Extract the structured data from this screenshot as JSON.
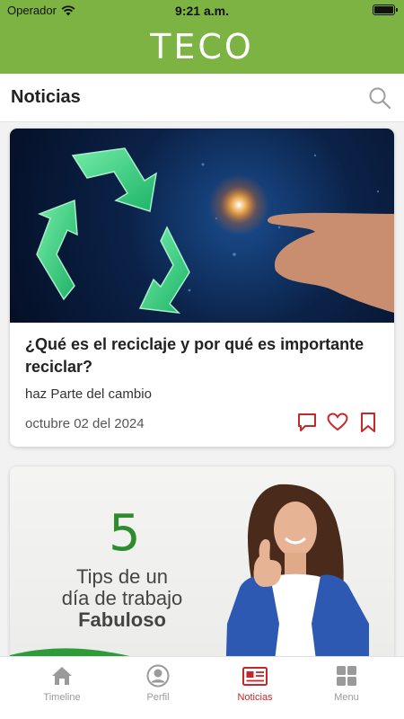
{
  "status": {
    "carrier": "Operador",
    "time": "9:21 a.m."
  },
  "header": {
    "brand": "TECO"
  },
  "section": {
    "title": "Noticias"
  },
  "articles": [
    {
      "title": "¿Qué es el reciclaje y por qué es importante reciclar?",
      "subtitle": "haz Parte del cambio",
      "date": "octubre 02 del 2024"
    },
    {
      "image_text": {
        "number": "5",
        "line1": "Tips de un",
        "line2": "día de trabajo",
        "line3": "Fabuloso"
      }
    }
  ],
  "tabs": [
    {
      "label": "Timeline",
      "icon": "home-icon"
    },
    {
      "label": "Perfil",
      "icon": "profile-icon"
    },
    {
      "label": "Noticias",
      "icon": "news-icon",
      "active": true
    },
    {
      "label": "Menu",
      "icon": "grid-icon"
    }
  ],
  "colors": {
    "header": "#7cb342",
    "accent": "#c62828"
  }
}
